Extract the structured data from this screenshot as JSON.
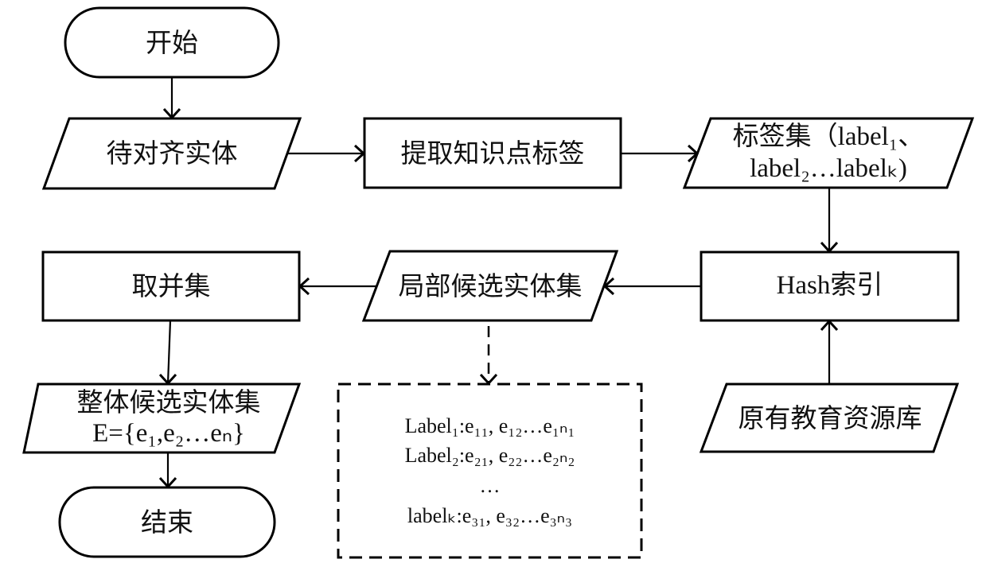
{
  "nodes": {
    "start": {
      "label": "开始"
    },
    "entity_to_align": {
      "label": "待对齐实体"
    },
    "extract_labels": {
      "label": "提取知识点标签"
    },
    "label_set": {
      "line1": "标签集（label₁、",
      "line2": "label₂…labelₖ)"
    },
    "hash_index": {
      "label": "Hash索引"
    },
    "original_resource_db": {
      "label": "原有教育资源库"
    },
    "local_candidate_set": {
      "label": "局部候选实体集"
    },
    "take_union": {
      "label": "取并集"
    },
    "overall_candidate_set": {
      "line1": "整体候选实体集",
      "line2": "E={e₁,e₂…eₙ}"
    },
    "end": {
      "label": "结束"
    }
  },
  "detail_box": {
    "lines": [
      "Label₁:e₁₁, e₁₂…e₁ₙ₁",
      "Label₂:e₂₁, e₂₂…e₂ₙ₂",
      "…",
      "labelₖ:e₃₁, e₃₂…e₃ₙ₃"
    ]
  },
  "edges": [
    {
      "from": "start",
      "to": "entity_to_align",
      "style": "solid"
    },
    {
      "from": "entity_to_align",
      "to": "extract_labels",
      "style": "solid"
    },
    {
      "from": "extract_labels",
      "to": "label_set",
      "style": "solid"
    },
    {
      "from": "label_set",
      "to": "hash_index",
      "style": "solid"
    },
    {
      "from": "original_resource_db",
      "to": "hash_index",
      "style": "solid"
    },
    {
      "from": "hash_index",
      "to": "local_candidate_set",
      "style": "solid"
    },
    {
      "from": "local_candidate_set",
      "to": "take_union",
      "style": "solid"
    },
    {
      "from": "local_candidate_set",
      "to": "detail_box",
      "style": "dashed"
    },
    {
      "from": "take_union",
      "to": "overall_candidate_set",
      "style": "solid"
    },
    {
      "from": "overall_candidate_set",
      "to": "end",
      "style": "solid"
    }
  ]
}
